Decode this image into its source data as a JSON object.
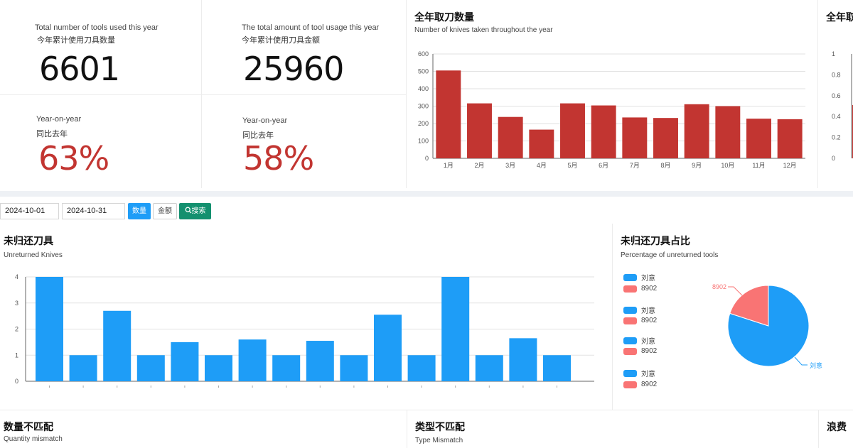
{
  "stats": {
    "tools_used": {
      "en": "Total number of tools used this year",
      "zh": "今年累计使用刀具数量",
      "value": "6601"
    },
    "tools_amount": {
      "en": "The total amount of tool usage this year",
      "zh": "今年累计使用刀具金额",
      "value": "25960"
    },
    "yoy_count": {
      "en": "Year-on-year",
      "zh": "同比去年",
      "value": "63%"
    },
    "yoy_amount": {
      "en": "Year-on-year",
      "zh": "同比去年",
      "value": "58%"
    }
  },
  "annual_chart": {
    "title": "全年取刀数量",
    "subtitle": "Number of knives taken throughout the year"
  },
  "clipped_chart": {
    "title": "全年取刀"
  },
  "filters": {
    "start_date": "2024-10-01",
    "end_date": "2024-10-31",
    "quantity_label": "数量",
    "amount_label": "金额",
    "search_label": "搜索"
  },
  "unreturned_chart": {
    "title": "未归还刀具",
    "subtitle": "Unreturned Knives"
  },
  "pie_chart": {
    "title": "未归还刀具占比",
    "subtitle": "Percentage of unreturned tools",
    "legend": [
      "刘意",
      "8902",
      "刘意",
      "8902",
      "刘意",
      "8902",
      "刘意",
      "8902"
    ]
  },
  "bottom": {
    "qty_title": "数量不匹配",
    "qty_sub": "Quantity mismatch",
    "type_title": "类型不匹配",
    "type_sub": "Type Mismatch",
    "waste_title": "浪费"
  },
  "colors": {
    "red": "#c23531",
    "blue": "#1e9df7",
    "pink": "#f97474",
    "teal": "#13906f"
  },
  "chart_data": [
    {
      "type": "bar",
      "categories": [
        "1月",
        "2月",
        "3月",
        "4月",
        "5月",
        "6月",
        "7月",
        "8月",
        "9月",
        "10月",
        "11月",
        "12月"
      ],
      "values": [
        505,
        316,
        238,
        165,
        316,
        304,
        235,
        232,
        311,
        300,
        228,
        225
      ],
      "ylim": [
        0,
        600
      ],
      "yticks": [
        0,
        100,
        200,
        300,
        400,
        500,
        600
      ],
      "title": "全年取刀数量",
      "subtitle": "Number of knives taken throughout the year",
      "grid": true
    },
    {
      "type": "bar",
      "values": [
        4,
        1,
        2.7,
        1,
        1.5,
        1,
        1.6,
        1,
        1.55,
        1,
        2.55,
        1,
        4,
        1,
        1.65,
        1
      ],
      "ylim": [
        0,
        4
      ],
      "yticks": [
        0,
        1,
        2,
        3,
        4
      ],
      "title": "未归还刀具",
      "subtitle": "Unreturned Knives",
      "grid": true
    },
    {
      "type": "pie",
      "slices": [
        {
          "label": "刘意",
          "value": 80
        },
        {
          "label": "8902",
          "value": 20
        }
      ],
      "title": "未归还刀具占比",
      "subtitle": "Percentage of unreturned tools"
    },
    {
      "type": "bar",
      "yticks": [
        "0",
        "0.2",
        "0.4",
        "0.6",
        "0.8",
        "1"
      ],
      "ylim": [
        0,
        1
      ],
      "title": "全年取刀"
    }
  ]
}
